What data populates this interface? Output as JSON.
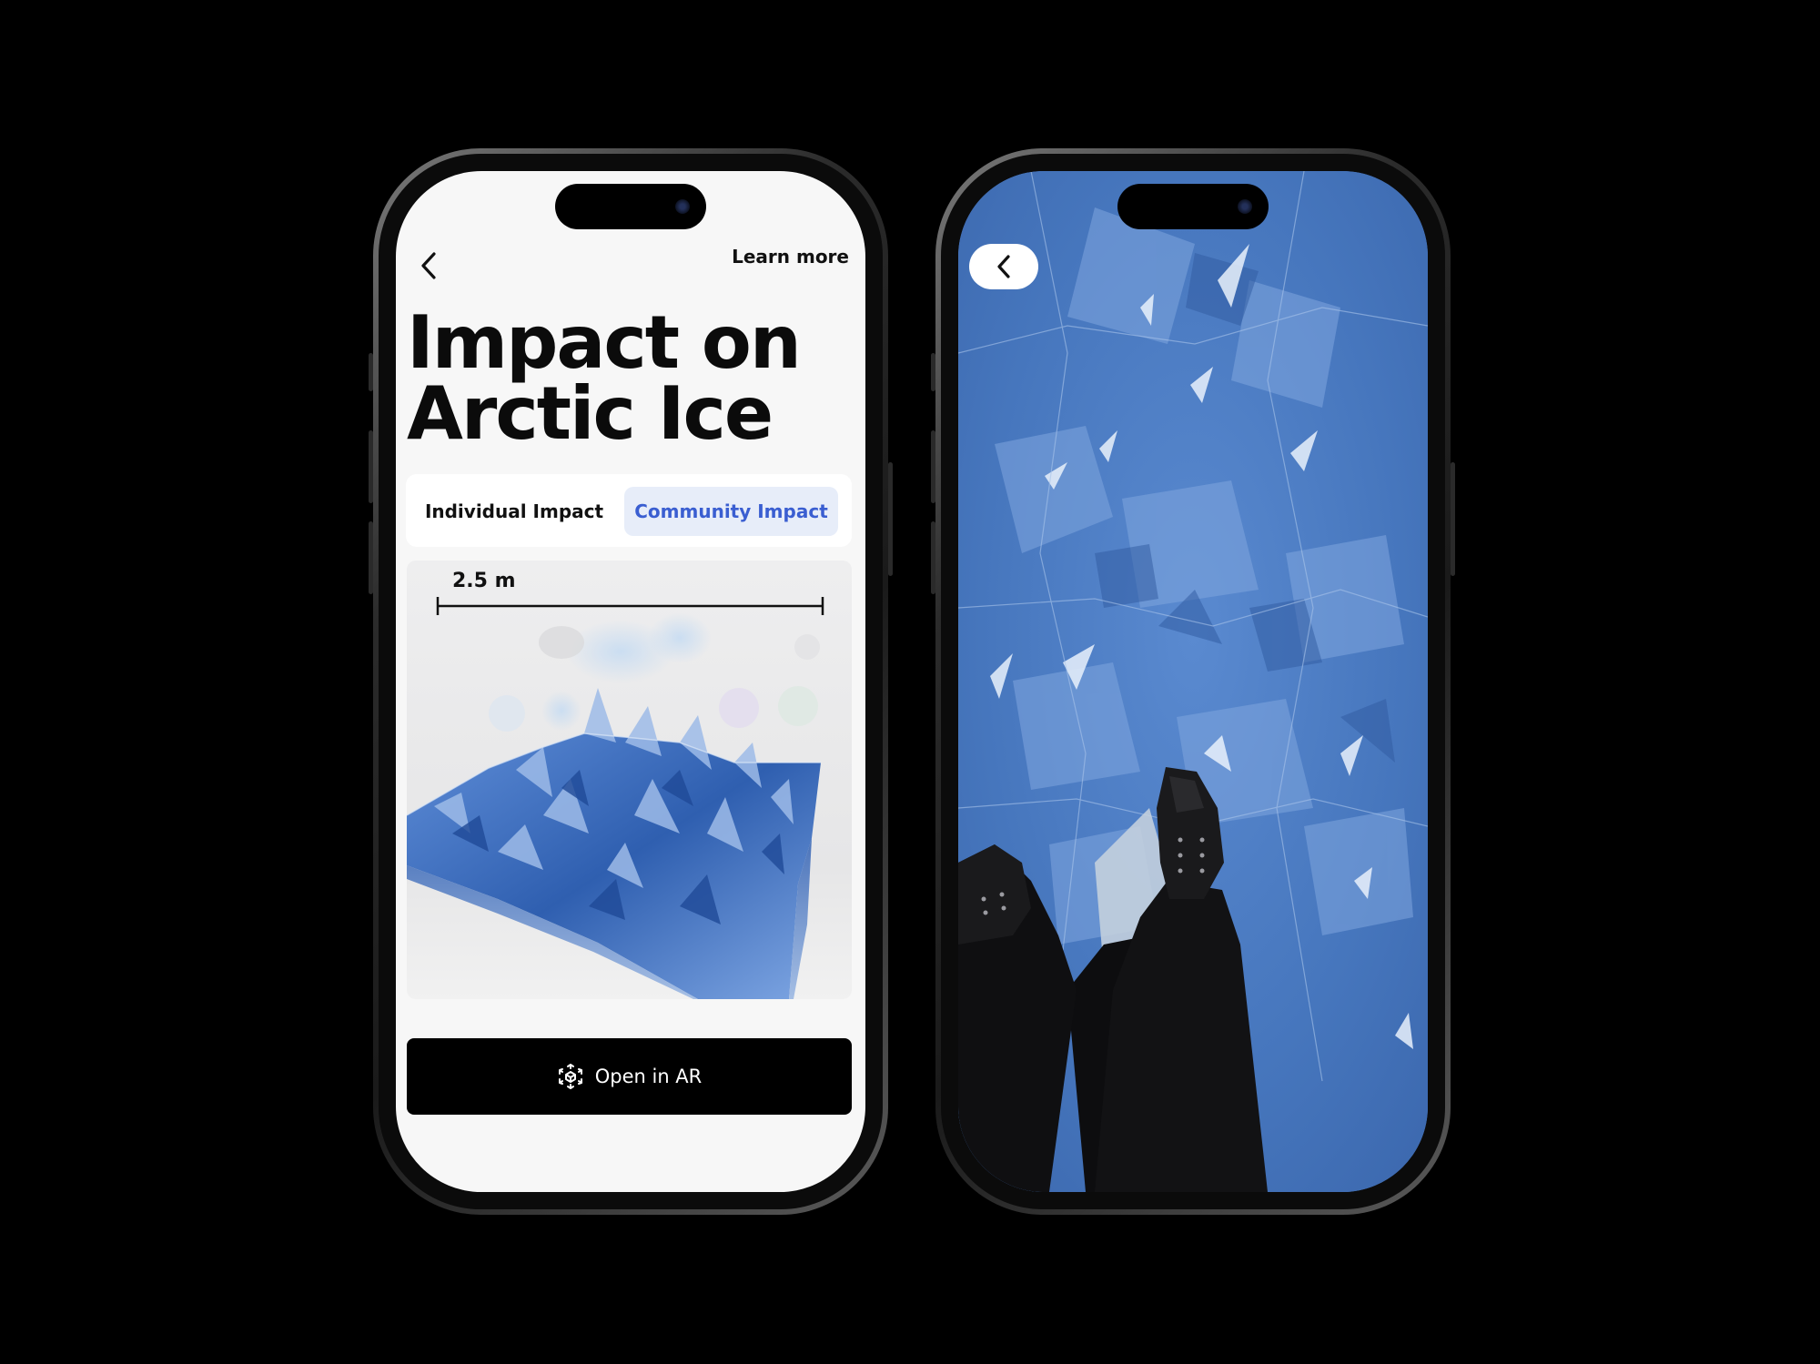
{
  "left_screen": {
    "back_icon": "chevron-left-icon",
    "learn_more": "Learn more",
    "title_line1": "Impact on",
    "title_line2": "Arctic Ice",
    "tabs": [
      {
        "label": "Individual Impact",
        "selected": false
      },
      {
        "label": "Community Impact",
        "selected": true
      }
    ],
    "scale_label": "2.5 m",
    "ar_button": {
      "label": "Open in AR",
      "icon": "ar-cube-icon"
    }
  },
  "right_screen": {
    "back_icon": "chevron-left-icon"
  },
  "colors": {
    "accent": "#3a5ed1",
    "accent_bg": "#e7edf9",
    "ice_blue": "#4d7bc0",
    "button_bg": "#000000",
    "screen_bg": "#f7f7f7"
  }
}
